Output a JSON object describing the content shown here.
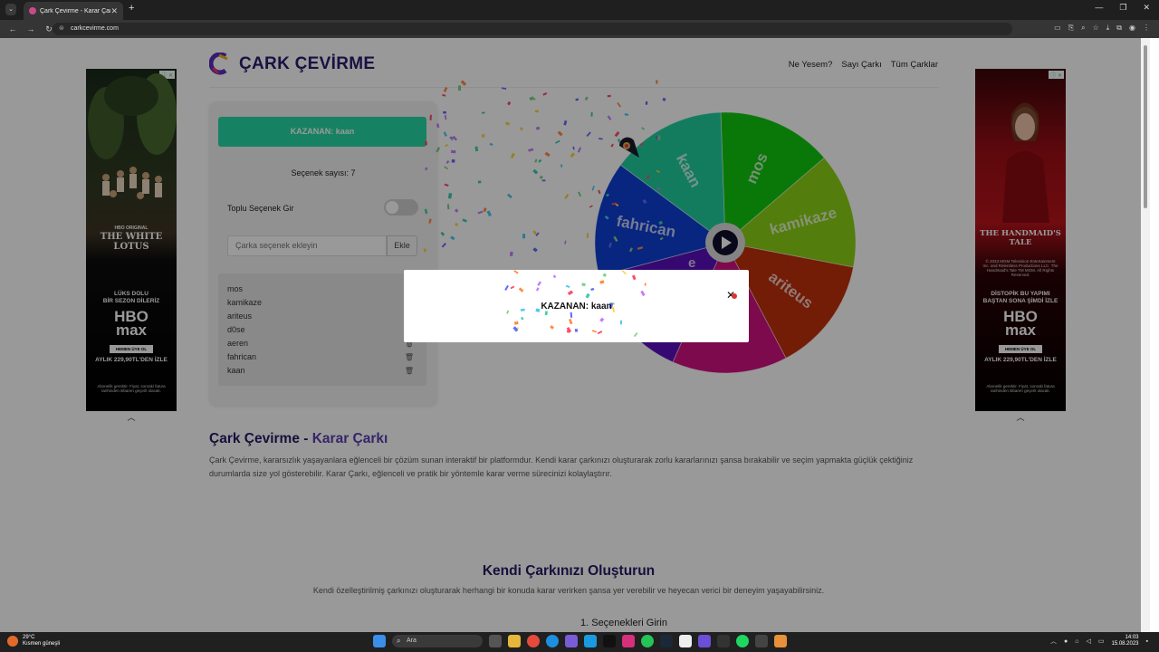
{
  "browser": {
    "tab_title": "Çark Çevirme - Karar Çarkı",
    "url": "carkcevirme.com"
  },
  "site": {
    "logo_text": "ÇARK ÇEVİRME",
    "nav": [
      "Ne Yesem?",
      "Sayı Çarkı",
      "Tüm Çarklar"
    ]
  },
  "panel": {
    "winner_banner": "KAZANAN: kaan",
    "option_count": "Seçenek sayısı: 7",
    "bulk_label": "Toplu Seçenek Gir",
    "bulk_enabled": false,
    "input_placeholder": "Çarka seçenek ekleyin",
    "add_button": "Ekle",
    "options": [
      "mos",
      "kamikaze",
      "ariteus",
      "d0se",
      "aeren",
      "fahrican",
      "kaan"
    ]
  },
  "wheel": {
    "segments": [
      {
        "label": "mos",
        "color": "#11c90f"
      },
      {
        "label": "kamikaze",
        "color": "#8ad014"
      },
      {
        "label": "ariteus",
        "color": "#c0300a"
      },
      {
        "label": "",
        "color": "#d1117f"
      },
      {
        "label": "",
        "color": "#5a0fbf"
      },
      {
        "label": "fahrican",
        "color": "#0e3ed6"
      },
      {
        "label": "kaan",
        "color": "#20cf9e"
      }
    ],
    "visible_partial_label": "e"
  },
  "modal": {
    "text": "KAZANAN: kaan"
  },
  "content": {
    "h2_part1": "Çark Çevirme -",
    "h2_part2": "Karar Çarkı",
    "paragraph": "Çark Çevirme, kararsızlık yaşayanlara eğlenceli bir çözüm sunan interaktif bir platformdur. Kendi karar çarkınızı oluşturarak zorlu kararlarınızı şansa bırakabilir ve seçim yapmakta güçlük çektiğiniz durumlarda size yol gösterebilir. Karar Çarkı, eğlenceli ve pratik bir yöntemle karar verme sürecinizi kolaylaştırır.",
    "section2_title": "Kendi Çarkınızı Oluşturun",
    "section2_sub": "Kendi özelleştirilmiş çarkınızı oluşturarak herhangi bir konuda karar verirken şansa yer verebilir ve heyecan verici bir deneyim yaşayabilirsiniz.",
    "step1": "1. Seçenekleri Girin"
  },
  "ads": {
    "left": {
      "tag": "ⓘ ✕",
      "brand": "HBO ORIGINAL",
      "title": "THE WHITE LOTUS",
      "line1": "LÜKS DOLU",
      "line2": "BİR SEZON DİLERİZ",
      "hbo1": "HBO",
      "hbo2": "max",
      "button": "HEMEN ÜYE OL",
      "price": "AYLIK 229,90TL'DEN İZLE",
      "fine": "Abonelik gerektir. Fiyat, sonraki fatura tarihinden itibaren geçerli olacak."
    },
    "right": {
      "tag": "ⓘ ✕",
      "title": "THE HANDMAID'S TALE",
      "fine_top": "© 2023 MGM Television Entertainment Inc. and Relentless Productions LLC. The Handmaid's Tale TM MGM. All Rights Reserved.",
      "line1": "DİSTOPİK BU YAPIMI",
      "line2": "BAŞTAN SONA ŞİMDİ İZLE",
      "hbo1": "HBO",
      "hbo2": "max",
      "button": "HEMEN ÜYE OL",
      "price": "AYLIK 229,90TL'DEN İZLE",
      "fine": "Abonelik gerektir. Fiyat, sonraki fatura tarihinden itibaren geçerli olacak."
    }
  },
  "taskbar": {
    "temp": "29°C",
    "weather": "Kısmen güneşli",
    "search": "Ara",
    "time": "14:03",
    "date": "15.08.2023"
  }
}
